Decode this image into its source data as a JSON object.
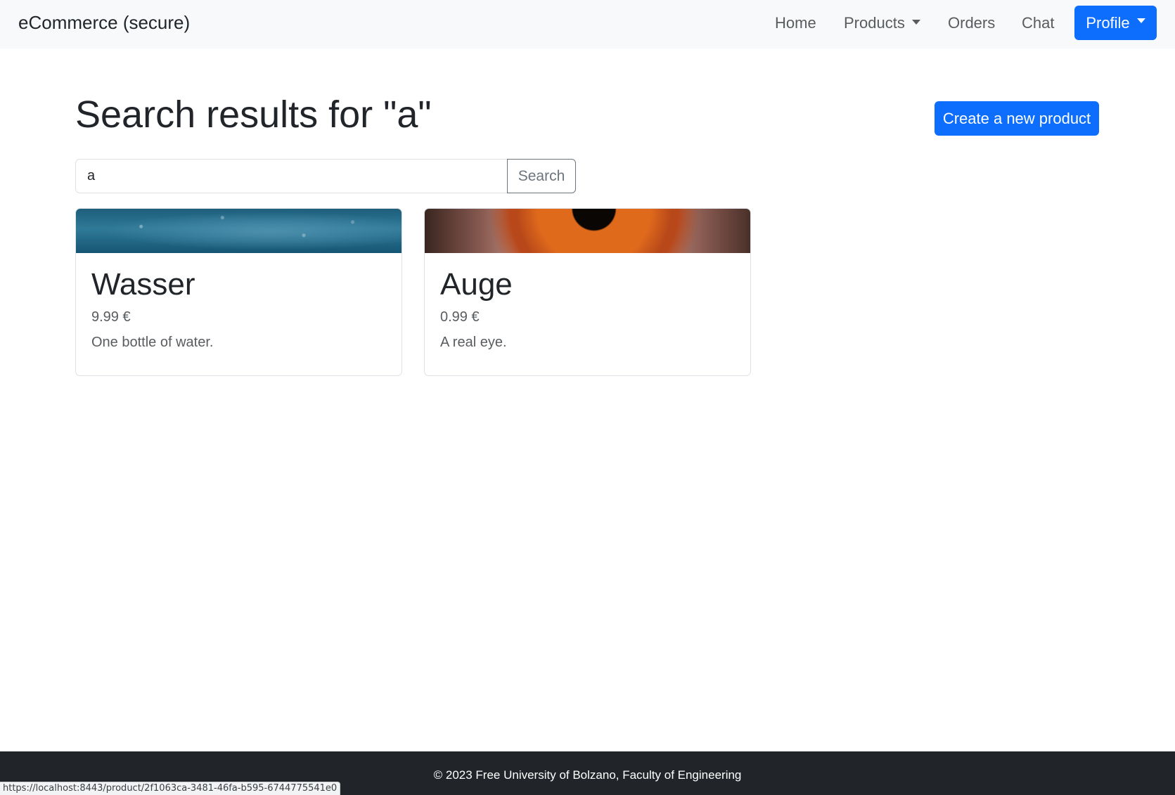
{
  "navbar": {
    "brand": "eCommerce (secure)",
    "links": {
      "home": "Home",
      "products": "Products",
      "orders": "Orders",
      "chat": "Chat"
    },
    "profile_label": "Profile"
  },
  "header": {
    "title": "Search results for \"a\"",
    "create_button": "Create a new product"
  },
  "search": {
    "value": "a",
    "button_label": "Search"
  },
  "products": [
    {
      "name": "Wasser",
      "price": "9.99 €",
      "description": "One bottle of water."
    },
    {
      "name": "Auge",
      "price": "0.99 €",
      "description": "A real eye."
    }
  ],
  "footer": {
    "text": "© 2023 Free University of Bolzano, Faculty of Engineering"
  },
  "status_bar": {
    "url": "https://localhost:8443/product/2f1063ca-3481-46fa-b595-6744775541e0"
  },
  "colors": {
    "primary": "#0d6efd",
    "navbar_bg": "#f8f9fa",
    "footer_bg": "#212529"
  }
}
